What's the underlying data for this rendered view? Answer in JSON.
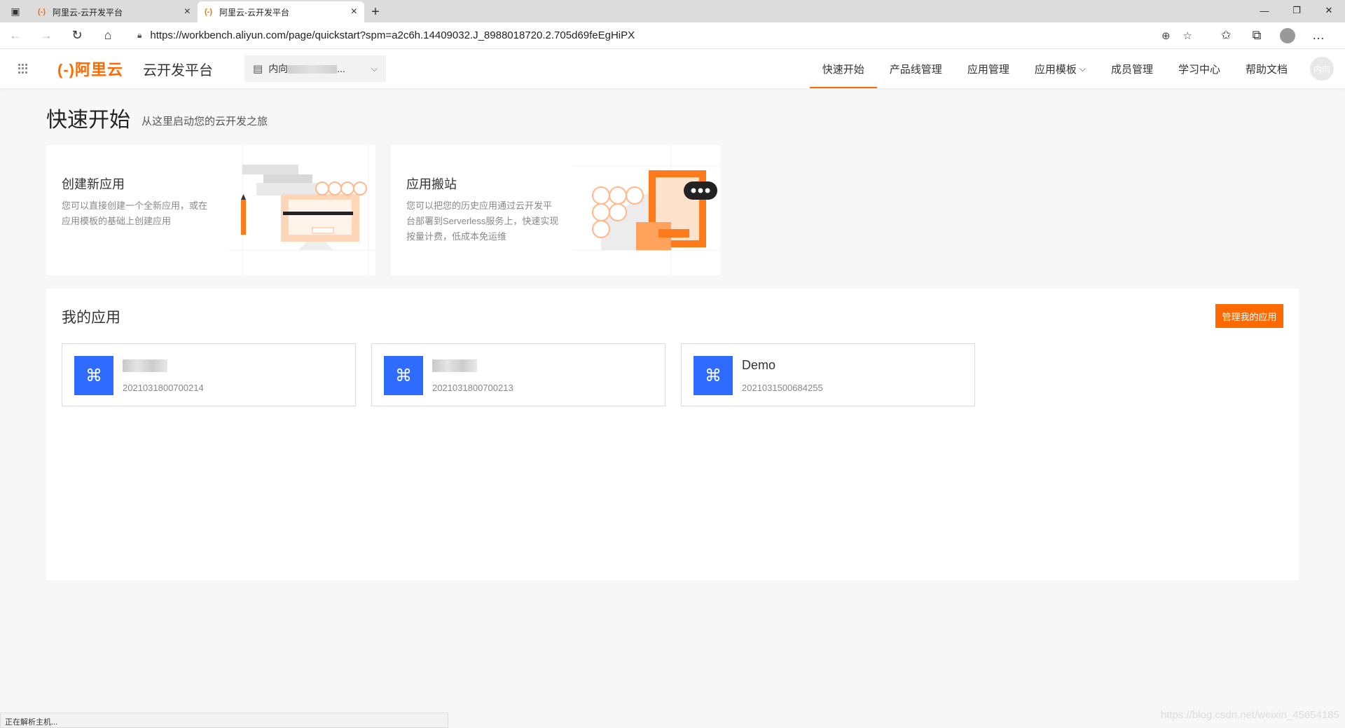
{
  "browser": {
    "tabs": [
      {
        "favicon": "(-)",
        "title": "阿里云-云开发平台",
        "active": false
      },
      {
        "favicon": "(-)",
        "title": "阿里云-云开发平台",
        "active": true
      }
    ],
    "url": "https://workbench.aliyun.com/page/quickstart?spm=a2c6h.14409032.J_8988018720.2.705d69feEgHiPX",
    "icons": [
      "back-icon",
      "forward-icon",
      "refresh-icon",
      "home-icon",
      "lock-icon",
      "zoom-icon",
      "favorite-add-icon",
      "favorites-icon",
      "collections-icon",
      "profile-icon",
      "more-icon"
    ]
  },
  "header": {
    "logo_text": "阿里云",
    "logo_bracket": "(-)",
    "platform_name": "云开发平台",
    "workspace": {
      "prefix": "内向",
      "suffix": "..."
    },
    "nav": [
      {
        "label": "快速开始",
        "active": true
      },
      {
        "label": "产品线管理"
      },
      {
        "label": "应用管理"
      },
      {
        "label": "应用模板",
        "dropdown": true
      },
      {
        "label": "成员管理"
      },
      {
        "label": "学习中心"
      },
      {
        "label": "帮助文档"
      }
    ],
    "avatar_text": "内向"
  },
  "page": {
    "title": "快速开始",
    "subtitle": "从这里启动您的云开发之旅"
  },
  "quick_cards": [
    {
      "title": "创建新应用",
      "desc": "您可以直接创建一个全新应用，或在应用模板的基础上创建应用"
    },
    {
      "title": "应用搬站",
      "desc": "您可以把您的历史应用通过云开发平台部署到Serverless服务上，快速实现按量计费，低成本免运维"
    }
  ],
  "my_apps": {
    "title": "我的应用",
    "manage_label": "管理我的应用",
    "apps": [
      {
        "name": "",
        "id": "2021031800700214"
      },
      {
        "name": "",
        "id": "2021031800700213"
      },
      {
        "name": "Demo",
        "id": "2021031500684255"
      }
    ]
  },
  "status": {
    "text": "正在解析主机...",
    "watermark": "https://blog.csdn.net/weixin_45654185"
  },
  "colors": {
    "accent": "#ff6a00",
    "app_icon": "#2f6bff"
  }
}
